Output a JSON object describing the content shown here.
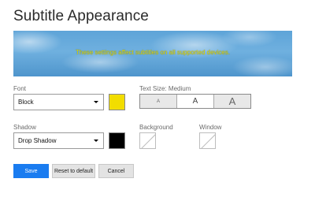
{
  "page": {
    "title": "Subtitle Appearance"
  },
  "preview": {
    "text": "These settings affect subtitles on all supported devices.",
    "text_color": "#e8e000"
  },
  "font": {
    "label": "Font",
    "selected": "Block",
    "color": "#f2dd00"
  },
  "text_size": {
    "label": "Text Size: Medium",
    "options": [
      "A",
      "A",
      "A"
    ],
    "selected_index": 1
  },
  "shadow": {
    "label": "Shadow",
    "selected": "Drop Shadow",
    "color": "#000000"
  },
  "background": {
    "label": "Background",
    "value": "none"
  },
  "window": {
    "label": "Window",
    "value": "none"
  },
  "buttons": {
    "save": "Save",
    "reset": "Reset to default",
    "cancel": "Cancel"
  },
  "colors": {
    "accent": "#1a7cf0"
  }
}
